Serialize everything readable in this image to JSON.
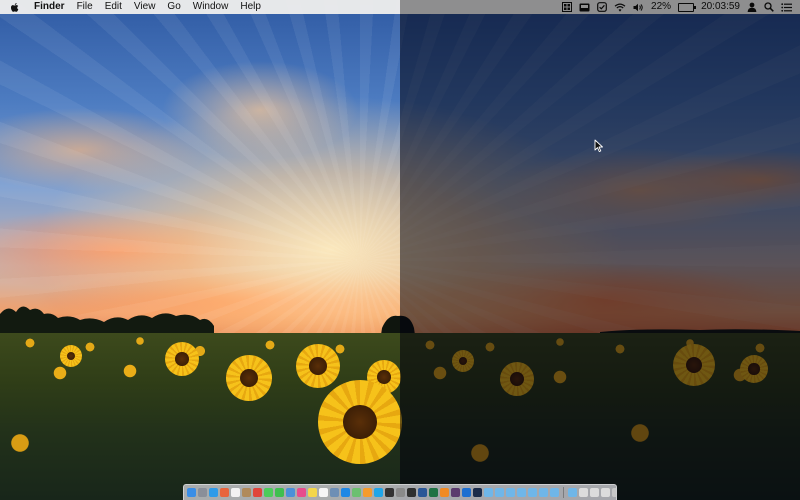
{
  "menubar": {
    "app_name": "Finder",
    "menus": [
      "File",
      "Edit",
      "View",
      "Go",
      "Window",
      "Help"
    ],
    "status": {
      "battery_percent_label": "22%",
      "battery_level": 0.22,
      "clock": "20:03:59",
      "icons": [
        "menu-extra-icon",
        "display-icon",
        "checkmark-circle-icon",
        "wifi-icon",
        "volume-icon",
        "battery-icon",
        "user-icon",
        "spotlight-search-icon",
        "notification-center-icon"
      ]
    }
  },
  "wallpaper": {
    "subject": "sunflower-field-sunset",
    "left_half": "normal",
    "right_half": "dimmed"
  },
  "dock": {
    "items": [
      {
        "name": "finder-icon",
        "color": "#3a8ee6"
      },
      {
        "name": "launchpad-icon",
        "color": "#8a8f99"
      },
      {
        "name": "safari-icon",
        "color": "#2f9be8"
      },
      {
        "name": "photos-icon",
        "color": "#e8643c"
      },
      {
        "name": "calendar-icon",
        "color": "#f2f2f2"
      },
      {
        "name": "contacts-icon",
        "color": "#b08a5a"
      },
      {
        "name": "chrome-icon",
        "color": "#e0453a"
      },
      {
        "name": "messages-icon",
        "color": "#4ccc5a"
      },
      {
        "name": "facetime-icon",
        "color": "#3fbf4f"
      },
      {
        "name": "mail-icon",
        "color": "#4a90d9"
      },
      {
        "name": "itunes-icon",
        "color": "#e74c8c"
      },
      {
        "name": "notes-icon",
        "color": "#f3d64a"
      },
      {
        "name": "reminders-icon",
        "color": "#f5f5f5"
      },
      {
        "name": "preview-icon",
        "color": "#6e8fb5"
      },
      {
        "name": "app-store-icon",
        "color": "#1e88e5"
      },
      {
        "name": "maps-icon",
        "color": "#6cc070"
      },
      {
        "name": "ibooks-icon",
        "color": "#f59b2b"
      },
      {
        "name": "skype-icon",
        "color": "#20a6e8"
      },
      {
        "name": "terminal-icon",
        "color": "#333333"
      },
      {
        "name": "system-preferences-icon",
        "color": "#8a8a8a"
      },
      {
        "name": "activity-monitor-icon",
        "color": "#2f2f2f"
      },
      {
        "name": "word-icon",
        "color": "#2b5797"
      },
      {
        "name": "excel-icon",
        "color": "#1f7244"
      },
      {
        "name": "vlc-icon",
        "color": "#f08a24"
      },
      {
        "name": "slack-icon",
        "color": "#5b3a6e"
      },
      {
        "name": "xcode-icon",
        "color": "#1d6fd1"
      },
      {
        "name": "photoshop-icon",
        "color": "#1a2b4a"
      },
      {
        "name": "folder-icon",
        "color": "#6fb6e8"
      },
      {
        "name": "folder-icon",
        "color": "#6fb6e8"
      },
      {
        "name": "folder-icon",
        "color": "#6fb6e8"
      },
      {
        "name": "folder-icon",
        "color": "#6fb6e8"
      },
      {
        "name": "folder-icon",
        "color": "#6fb6e8"
      },
      {
        "name": "folder-icon",
        "color": "#6fb6e8"
      },
      {
        "name": "folder-icon",
        "color": "#6fb6e8"
      },
      {
        "name": "folder-icon",
        "color": "#6fb6e8"
      },
      {
        "name": "document-icon",
        "color": "#dcdcdc"
      },
      {
        "name": "document-icon",
        "color": "#dcdcdc"
      },
      {
        "name": "document-icon",
        "color": "#dcdcdc"
      },
      {
        "name": "trash-icon",
        "color": "#c8c8c8"
      }
    ],
    "separator_after": 34
  }
}
